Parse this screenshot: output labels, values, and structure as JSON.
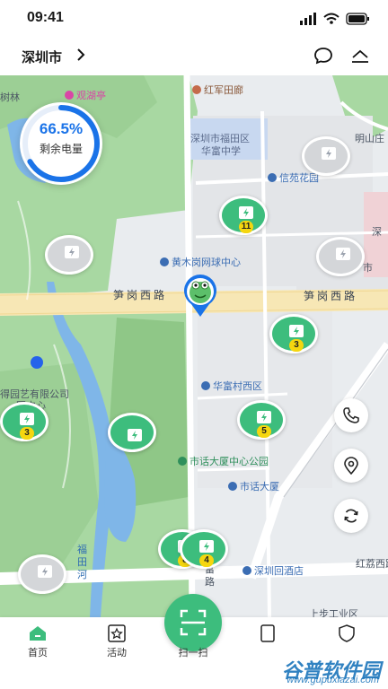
{
  "status_bar": {
    "time": "09:41"
  },
  "header": {
    "city": "深圳市"
  },
  "battery": {
    "percent_text": "66.5%",
    "label": "剩余电量",
    "level": 0.665
  },
  "colors": {
    "primary": "#3dbd7d",
    "accent_blue": "#1a73e8",
    "badge": "#f5d60f"
  },
  "map_labels": {
    "l1": "树林",
    "l2": "观湖亭",
    "l3": "红军田廊",
    "l4": "深圳市福田区",
    "l5": "华富中学",
    "l6": "明山庄",
    "l7": "信苑花园",
    "l8": "黄木岗网球中心",
    "l9": "笋岗西路",
    "l10": "笋岗西路",
    "l11": "得园艺有限公司",
    "l12": "园中心",
    "l13": "华富村西区",
    "l14": "市话大厦中心公园",
    "l15": "市话大厦",
    "l16": "福田河",
    "l17": "华富路",
    "l18": "深圳回酒店",
    "l19": "红荔西路",
    "l20": "上步工业区",
    "l21": "深",
    "l22": "市"
  },
  "stations": [
    {
      "count": "11"
    },
    {
      "count": "3"
    },
    {
      "count": "3"
    },
    {
      "count": "5"
    },
    {
      "count": "8"
    },
    {
      "count": "4"
    }
  ],
  "tabs": {
    "home": "首页",
    "activity": "活动",
    "scan": "扫一扫"
  },
  "watermark": {
    "brand": "谷普软件园",
    "url": "www.gupuxlazai.com"
  }
}
